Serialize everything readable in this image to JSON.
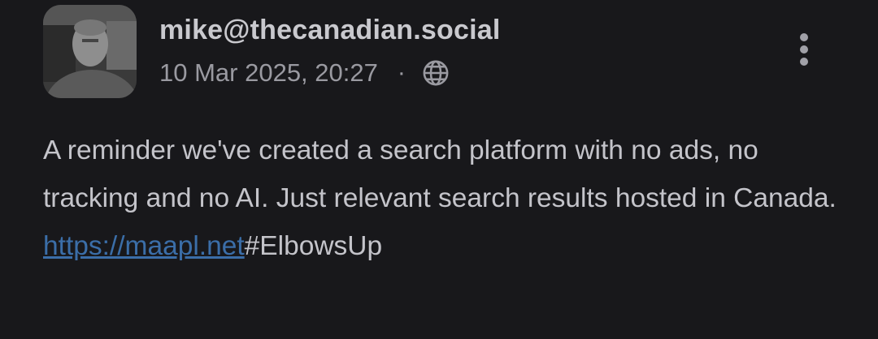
{
  "post": {
    "author": "mike@thecanadian.social",
    "timestamp": "10 Mar 2025, 20:27",
    "separator": "·",
    "visibility_icon": "globe-icon",
    "menu_icon": "more-vertical-icon",
    "content": {
      "text": "A reminder we've created a search platform with no ads, no tracking and no AI. Just relevant search results hosted in Canada. ",
      "link_text": "https://maapl.net",
      "hashtag": "#ElbowsUp"
    }
  },
  "colors": {
    "background": "#18181b",
    "author": "#c9c9ce",
    "meta": "#9a9aa1",
    "body_text": "#c4c4ca",
    "link": "#3b6ea8"
  }
}
